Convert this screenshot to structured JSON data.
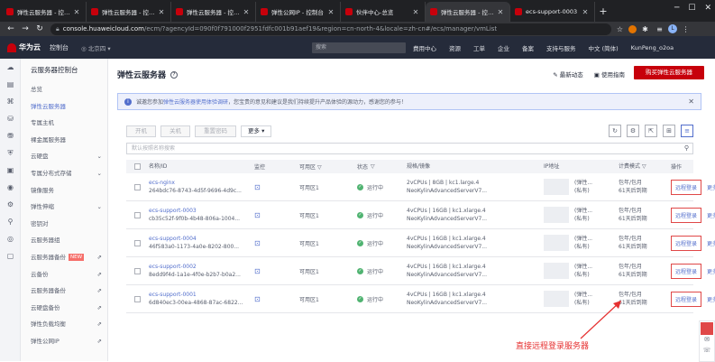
{
  "browser": {
    "tabs": [
      {
        "title": "弹性云服务器 - 控制台",
        "active": false
      },
      {
        "title": "弹性云服务器 - 控制台",
        "active": false
      },
      {
        "title": "弹性云服务器 - 控制台",
        "active": false
      },
      {
        "title": "弹性公网IP - 控制台",
        "active": false
      },
      {
        "title": "伙伴中心-总览",
        "active": false
      },
      {
        "title": "弹性云服务器 - 控制台",
        "active": true
      },
      {
        "title": "ecs-support-0003",
        "active": false
      }
    ],
    "url_domain": "console.huaweicloud.com",
    "url_path": "/ecm/?agencyId=090f0f791000f2951fdfc001b91aef19&region=cn-north-4&locale=zh-cn#/ecs/manager/vmList",
    "profile_initial": "L"
  },
  "topbar": {
    "brand": "华为云",
    "console": "控制台",
    "region": "北京四",
    "search_placeholder": "搜索",
    "nav": [
      "费用中心",
      "资源",
      "工单",
      "企业",
      "备案",
      "支持与服务",
      "中文 (简体)",
      "KunPeng_o2oa"
    ]
  },
  "sidebar": {
    "title": "云服务器控制台",
    "items": [
      {
        "label": "总览",
        "active": false
      },
      {
        "label": "弹性云服务器",
        "active": true
      },
      {
        "label": "专属主机",
        "active": false
      },
      {
        "label": "裸金属服务器",
        "active": false
      },
      {
        "label": "云硬盘",
        "active": false,
        "arrow": true
      },
      {
        "label": "专属分布式存储",
        "active": false,
        "arrow": true
      },
      {
        "label": "镜像服务",
        "active": false
      },
      {
        "label": "弹性伸缩",
        "active": false,
        "arrow": true
      },
      {
        "label": "密钥对",
        "active": false
      },
      {
        "label": "云服务器组",
        "active": false
      },
      {
        "label": "云服务器备份",
        "active": false,
        "badge": "NEW",
        "ext": true
      },
      {
        "label": "云备份",
        "active": false,
        "ext": true
      },
      {
        "label": "云服务器备份",
        "active": false,
        "ext": true
      },
      {
        "label": "云硬盘备份",
        "active": false,
        "ext": true
      },
      {
        "label": "弹性负载均衡",
        "active": false,
        "ext": true
      },
      {
        "label": "弹性公网IP",
        "active": false,
        "ext": true
      }
    ]
  },
  "page": {
    "title": "弹性云服务器",
    "help": "?",
    "latest": "最新动态",
    "guide": "使用指南",
    "buy": "购买弹性云服务器",
    "notice_pre": "诚邀您参加",
    "notice_link": "弹性云服务器使用体验调研",
    "notice_post": "，您宝贵的意见和建议是我们持续提升产品体验的源动力，感谢您的参与！",
    "btn_start": "开机",
    "btn_stop": "关机",
    "btn_reset": "重置密码",
    "btn_more": "更多",
    "filter_placeholder": "默认按照名称搜索"
  },
  "table": {
    "headers": [
      "名称/ID",
      "监控",
      "可用区",
      "状态",
      "规格/镜像",
      "IP地址",
      "计费模式",
      "操作"
    ],
    "rows": [
      {
        "name": "ecs-nginx",
        "id": "264bdc76-8743-4d5f-9696-4d9c...",
        "az": "可用区1",
        "status": "运行中",
        "spec": "2vCPUs | 8GB | kc1.large.4",
        "image": "NeoKylinAdvancedServerV7...",
        "ip1": "(弹性...",
        "ip2": "(私有)",
        "bill1": "包年/包月",
        "bill2": "61天后到期",
        "login": "远程登录",
        "more": "更多"
      },
      {
        "name": "ecs-support-0003",
        "id": "cb35c52f-9f0b-4b48-806a-1004...",
        "az": "可用区1",
        "status": "运行中",
        "spec": "4vCPUs | 16GB | kc1.xlarge.4",
        "image": "NeoKylinAdvancedServerV7...",
        "ip1": "(弹性...",
        "ip2": "(私有)",
        "bill1": "包年/包月",
        "bill2": "61天后到期",
        "login": "远程登录",
        "more": "更多"
      },
      {
        "name": "ecs-support-0004",
        "id": "46f583a0-1173-4a0e-8202-800...",
        "az": "可用区1",
        "status": "运行中",
        "spec": "4vCPUs | 16GB | kc1.xlarge.4",
        "image": "NeoKylinAdvancedServerV7...",
        "ip1": "(弹性...",
        "ip2": "(私有)",
        "bill1": "包年/包月",
        "bill2": "61天后到期",
        "login": "远程登录",
        "more": "更多"
      },
      {
        "name": "ecs-support-0002",
        "id": "8edd9f4d-1a1e-4f0e-b2b7-b0a2...",
        "az": "可用区1",
        "status": "运行中",
        "spec": "4vCPUs | 16GB | kc1.xlarge.4",
        "image": "NeoKylinAdvancedServerV7...",
        "ip1": "(弹性...",
        "ip2": "(私有)",
        "bill1": "包年/包月",
        "bill2": "61天后到期",
        "login": "远程登录",
        "more": "更多"
      },
      {
        "name": "ecs-support-0001",
        "id": "6d840ec3-00ea-4868-87ac-6822...",
        "az": "可用区1",
        "status": "运行中",
        "spec": "4vCPUs | 16GB | kc1.xlarge.4",
        "image": "NeoKylinAdvancedServerV7...",
        "ip1": "(弹性...",
        "ip2": "(私有)",
        "bill1": "包年/包月",
        "bill2": "61天后到期",
        "login": "远程登录",
        "more": "更多"
      }
    ]
  },
  "annotation": {
    "text": "直接远程登录服务器",
    "color": "#e63232"
  },
  "colors": {
    "brand": "#c7000b",
    "link": "#526ecc",
    "running": "#50b371",
    "topbar": "#252b3a"
  }
}
